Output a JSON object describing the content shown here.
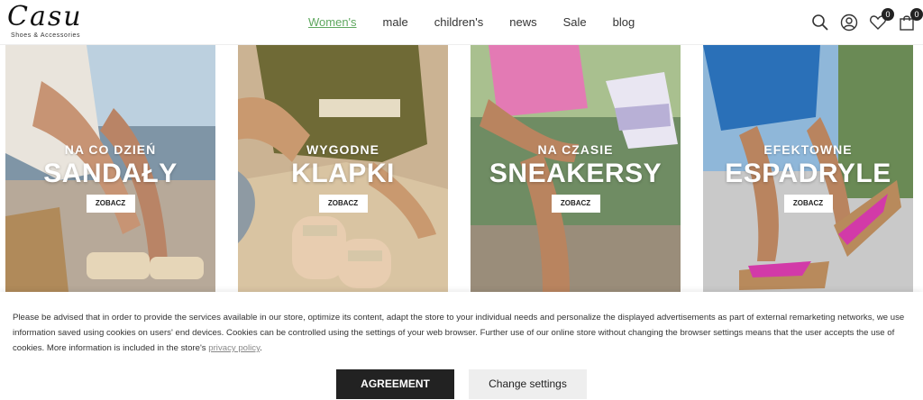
{
  "brand": {
    "name": "Casu",
    "tagline": "Shoes & Accessories"
  },
  "nav": [
    {
      "label": "Women's",
      "active": true
    },
    {
      "label": "male"
    },
    {
      "label": "children's"
    },
    {
      "label": "news"
    },
    {
      "label": "Sale"
    },
    {
      "label": "blog"
    }
  ],
  "header_icons": {
    "search": "search-icon",
    "account": "user-icon",
    "wishlist": {
      "icon": "heart-icon",
      "count": "0"
    },
    "cart": {
      "icon": "bag-icon",
      "count": "0"
    }
  },
  "tiles": [
    {
      "kicker": "NA CO DZIEŃ",
      "headline": "SANDAŁY",
      "cta": "ZOBACZ"
    },
    {
      "kicker": "WYGODNE",
      "headline": "KLAPKI",
      "cta": "ZOBACZ"
    },
    {
      "kicker": "NA CZASIE",
      "headline": "SNEAKERSY",
      "cta": "ZOBACZ"
    },
    {
      "kicker": "EFEKTOWNE",
      "headline": "ESPADRYLE",
      "cta": "ZOBACZ"
    }
  ],
  "cookie": {
    "text": "Please be advised that in order to provide the services available in our store, optimize its content, adapt the store to your individual needs and personalize the displayed advertisements as part of external remarketing networks, we use information saved using cookies on users' end devices. Cookies can be controlled using the settings of your web browser. Further use of our online store without changing the browser settings means that the user accepts the use of cookies. More information is included in the store's",
    "link": "privacy policy",
    "after_link": ".",
    "agree": "AGREEMENT",
    "settings": "Change settings"
  },
  "colors": {
    "nav_active": "#5fa85f",
    "button_dark": "#222222",
    "button_light": "#eeeeee"
  }
}
